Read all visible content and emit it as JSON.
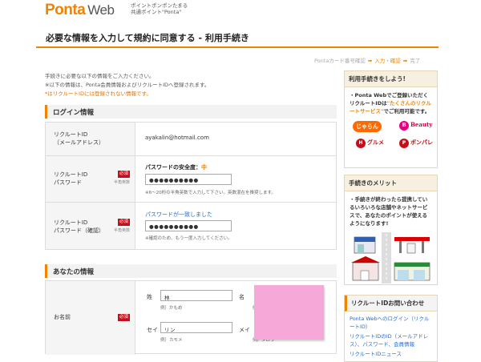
{
  "header": {
    "logo_ponta": "Ponta",
    "logo_web": "Web",
    "tagline_line1": "ポイントポンポンたまる",
    "tagline_line2": "共通ポイント\"Ponta\""
  },
  "page": {
    "title": "必要な情報を入力して規約に同意する - 利用手続き"
  },
  "steps": {
    "step1": "Pontaカード番号確認",
    "step2": "入力・確認",
    "step3": "完了",
    "arrow": "➡"
  },
  "intro": {
    "line1": "手続きに必要な以下の情報をご入力ください。",
    "line2": "※以下の情報は、Ponta会員情報およびリクルートIDへ登録されます。",
    "line3": "*はリクルートIDには登録されない情報です。"
  },
  "login_section": {
    "title": "ログイン情報",
    "recruit_id_label1": "リクルートID",
    "recruit_id_label2": "（メールアドレス）",
    "recruit_id_value": "ayakalin@hotmail.com",
    "password_label1": "リクルートID",
    "password_label2": "パスワード",
    "required": "必須",
    "hint_half": "半角英数",
    "strength_prefix": "パスワードの安全度：",
    "strength_level": "中",
    "password_value": "●●●●●●●●●●",
    "password_note": "※6～20桁の半角英数で入力して下さい。英数混在を推奨します。",
    "confirm_label1": "リクルートID",
    "confirm_label2": "パスワード（確認）",
    "match_text": "パスワードが一致しました",
    "confirm_value": "●●●●●●●●●●",
    "confirm_note": "※確認のため、もう一度入力してください。"
  },
  "you_section": {
    "title": "あなたの情報",
    "name_label": "お名前",
    "required": "必須",
    "sei_label": "姓",
    "sei_value": "林",
    "sei_example": "例）かもめ",
    "mei_label": "名",
    "mei_example": "例）",
    "sei_kana_label": "セイ",
    "sei_kana_value": "リン",
    "sei_kana_example": "例）カモメ",
    "mei_kana_label": "メイ",
    "mei_kana_example": "例）タロウ"
  },
  "sidebar": {
    "promo_title": "利用手続きをしよう!",
    "promo_text1": "・Ponta Webでご登録いただくリクルートIDは",
    "promo_text_orange": "\"たくさんのリクルートサービス\"",
    "promo_text2": "でご利用可能です。",
    "svc_jalan": "じゃらん",
    "svc_beauty": "Beauty",
    "svc_gourmet": "グルメ",
    "svc_gourmet_badge": "H",
    "svc_ponpare": "ポンパレ",
    "svc_ponpare_badge": "P",
    "merit_title": "手続きのメリット",
    "merit_text": "・手続きが終わったら提携しているいろいろな店舗やネットサービスで、あなたのポイントが使えるようになります!",
    "inquiry_title": "リクルートIDお問い合わせ",
    "links": [
      "Ponta Webへのログイン（リクルートID）",
      "リクルートIDのID（メールアドレス）、パスワード、会員情報",
      "リクルートIDニュース"
    ]
  },
  "colors": {
    "brand": "#f08300",
    "required": "#c40f1a",
    "link": "#2a6bd0",
    "sticky": "#f6a8d8"
  }
}
